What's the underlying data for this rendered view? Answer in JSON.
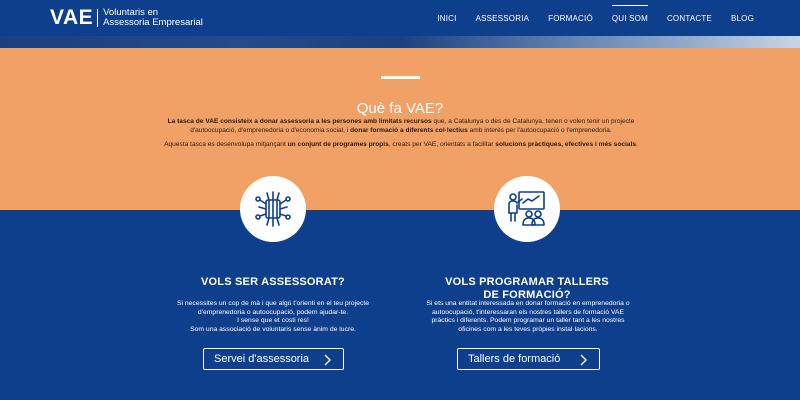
{
  "header": {
    "logo_mark": "VAE",
    "logo_line1": "Voluntaris en",
    "logo_line2": "Assessoria Empresarial",
    "nav": [
      {
        "label": "INICI"
      },
      {
        "label": "ASSESSORIA"
      },
      {
        "label": "FORMACIÓ"
      },
      {
        "label": "QUI SOM",
        "active": true
      },
      {
        "label": "CONTACTE"
      },
      {
        "label": "BLOG"
      }
    ]
  },
  "about": {
    "title": "Què fa VAE?",
    "p1_b1": "La tasca de VAE consisteix a donar assessoria a les persones amb limitats recursos",
    "p1_t1": " que, a Catalunya o des de Catalunya, tenen o volen tenir un projecte d'autoocupació, d'emprenedoria o d'economia social, i ",
    "p1_b2": "donar formació a diferents col·lectius",
    "p1_t2": " amb interès per l'autoocupació o l'emprenedoria.",
    "p2_t1": "Aquesta tasca es desenvolupa mitjançant ",
    "p2_b1": "un conjunt de programes propis",
    "p2_t2": ", creats per VAE, orientats a facilitar ",
    "p2_b2": "solucions pràctiques, efectives i més socials",
    "p2_t3": "."
  },
  "columns": {
    "left": {
      "icon": "hands-together-icon",
      "title": "VOLS SER ASSESSORAT?",
      "lines": [
        "Si necessites un cop de mà i que algú t'orienti en el teu projecte",
        "d'emprenedoria o autoocupació, podem ajudar-te.",
        "I sense que et costi res!",
        "Som una associació de voluntaris sense ànim de lucre."
      ],
      "button": "Servei d'assessoria"
    },
    "right": {
      "icon": "training-presentation-icon",
      "title_line1": "VOLS PROGRAMAR TALLERS",
      "title_line2": "DE FORMACIÓ?",
      "lines": [
        "Si ets una entitat interessada en donar formació en emprenedoria o",
        "autoocupació, t'interessaran els nostres tallers de formació VAE",
        "pràctics i diferents. Podem programar un taller tant a les nostres",
        "oficines com a les teves pròpies instal·lacions."
      ],
      "button": "Tallers de formació"
    }
  },
  "colors": {
    "navy": "#0e3f8c",
    "orange": "#f1a165",
    "white": "#ffffff"
  }
}
